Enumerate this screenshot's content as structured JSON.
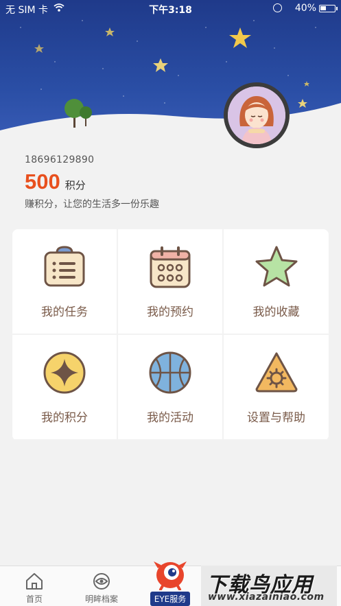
{
  "status_bar": {
    "carrier": "无 SIM 卡",
    "time": "下午3:18",
    "battery": "40%",
    "battery_level": 0.4
  },
  "profile": {
    "phone": "18696129890",
    "points": "500",
    "points_unit": "积分",
    "slogan": "赚积分，让您的生活多一份乐趣"
  },
  "menu": [
    {
      "label": "我的任务",
      "icon": "clipboard-list-icon"
    },
    {
      "label": "我的预约",
      "icon": "calendar-icon"
    },
    {
      "label": "我的收藏",
      "icon": "star-icon"
    },
    {
      "label": "我的积分",
      "icon": "coin-diamond-icon"
    },
    {
      "label": "我的活动",
      "icon": "basketball-icon"
    },
    {
      "label": "设置与帮助",
      "icon": "gear-triangle-icon"
    }
  ],
  "tabbar": {
    "home": "首页",
    "archive": "明眸档案",
    "eye_service": "EYE服务"
  },
  "watermark": {
    "title": "下载鸟应用",
    "url": "www.xiazainiao.com"
  }
}
